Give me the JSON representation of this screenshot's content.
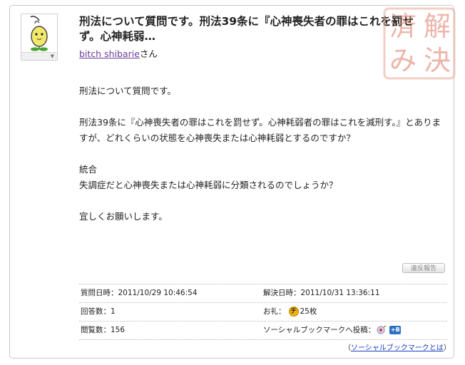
{
  "question": {
    "title": "刑法について質問です。刑法39条に『心神喪失者の罪はこれを罰せず。心神耗弱…",
    "author_name": "bitch shibarie",
    "author_suffix": "さん",
    "body": [
      "刑法について質問です。",
      "",
      "刑法39条に『心神喪失者の罪はこれを罰せず。心神耗弱者の罪はこれを減刑す。』とありますが、どれくらいの状態を心神喪失または心神耗弱とするのですか？",
      "",
      "統合",
      "失調症だと心神喪失または心神耗弱に分類されるのでしょうか？",
      "",
      "宜しくお願いします。"
    ],
    "report_label": "違反報告"
  },
  "stamp": {
    "chars": [
      "解",
      "決",
      "済",
      "み"
    ],
    "color": "#e07a66"
  },
  "meta": {
    "asked_label": "質問日時：",
    "asked_value": "2011/10/29 10:46:54",
    "resolved_label": "解決日時：",
    "resolved_value": "2011/10/31 13:36:11",
    "answers_label": "回答数：",
    "answers_value": "1",
    "reward_label": "お礼：",
    "reward_value": "25枚",
    "views_label": "閲覧数：",
    "views_value": "156",
    "bookmark_label": "ソーシャルブックマークへ投稿：",
    "about_open": "（",
    "about_link": "ソーシャルブックマークとは",
    "about_close": "）"
  },
  "icons": {
    "avatar": "sprout-character-avatar",
    "reward": "chiebukuro-coin-icon",
    "yahoo_bookmark": "yahoo-bookmark-icon",
    "hatena_bookmark": "hatena-bookmark-icon"
  },
  "colors": {
    "author_link": "#6a3d9a",
    "link": "#1a3ec0",
    "stamp": "#e07a66"
  }
}
